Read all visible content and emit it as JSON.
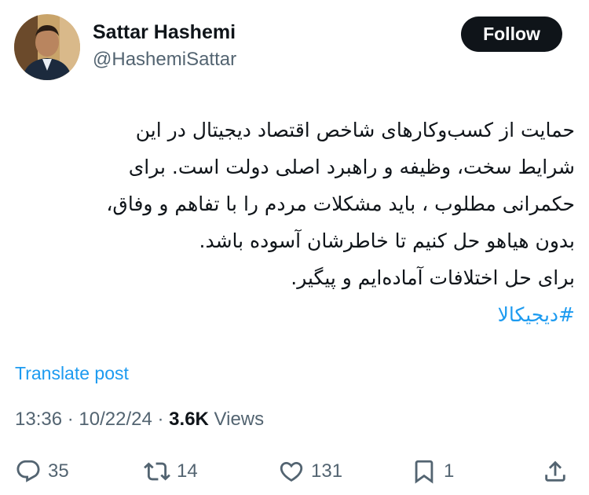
{
  "author": {
    "name": "Sattar Hashemi",
    "handle": "@HashemiSattar"
  },
  "follow_label": "Follow",
  "post": {
    "lines": [
      "حمایت از کسب‌وکارهای شاخص اقتصاد دیجیتال در این",
      "شرایط سخت، وظیفه و راهبرد اصلی دولت است. برای",
      "حکمرانی مطلوب ، باید مشکلات مردم را با تفاهم و وفاق،",
      "بدون هیاهو حل کنیم تا خاطرشان آسوده باشد.",
      "برای حل اختلافات آماده‌ایم و پیگیر."
    ],
    "hashtag": "#دیجیکالا"
  },
  "translate_label": "Translate post",
  "meta": {
    "time": "13:36",
    "separator": "·",
    "date": "10/22/24",
    "views_count": "3.6K",
    "views_label": "Views"
  },
  "actions": {
    "replies": "35",
    "reposts": "14",
    "likes": "131",
    "bookmarks": "1"
  },
  "icons": {
    "reply": "reply-icon",
    "repost": "repost-icon",
    "like": "heart-icon",
    "bookmark": "bookmark-icon",
    "share": "share-icon"
  },
  "colors": {
    "link": "#1d9bf0",
    "text": "#0f1419",
    "secondary": "#536471",
    "follow_bg": "#0f1419"
  }
}
